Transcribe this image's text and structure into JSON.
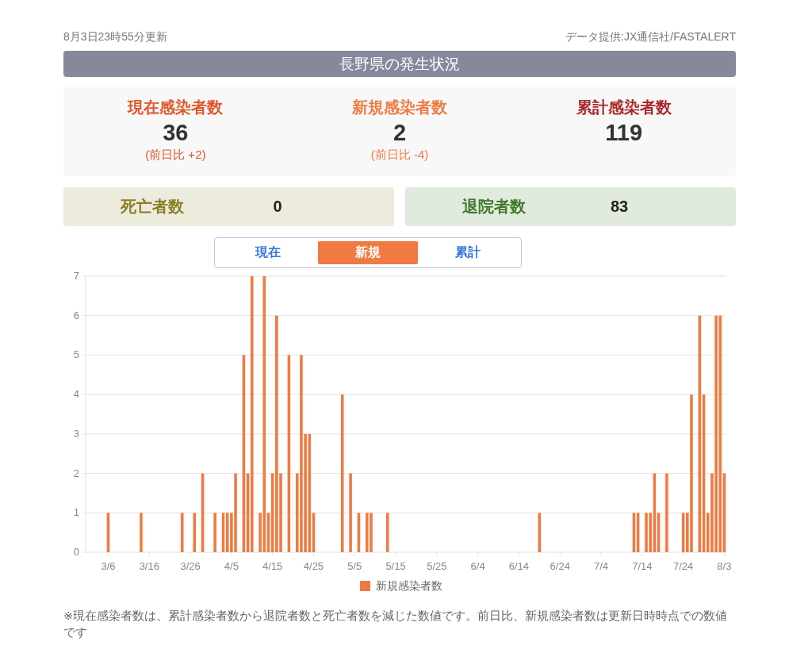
{
  "updated": "8月3日23時55分更新",
  "source": "データ提供:JX通信社/FASTALERT",
  "title": "長野県の発生状況",
  "stats": [
    {
      "label": "現在感染者数",
      "value": "36",
      "change": "(前日比 +2)",
      "color": "#e0562a"
    },
    {
      "label": "新規感染者数",
      "value": "2",
      "change": "(前日比 -4)",
      "color": "#f07a41"
    },
    {
      "label": "累計感染者数",
      "value": "119",
      "color": "#a8282a"
    }
  ],
  "summary_boxes": [
    {
      "label": "死亡者数",
      "value": "0",
      "color": "#8a7f25"
    },
    {
      "label": "退院者数",
      "value": "83",
      "color": "#3d7a2a"
    }
  ],
  "tabs": [
    {
      "label": "現在",
      "selected": false
    },
    {
      "label": "新規",
      "selected": true
    },
    {
      "label": "累計",
      "selected": false
    }
  ],
  "chart_data": {
    "type": "bar",
    "categories": [
      null,
      null,
      null,
      null,
      null,
      "3/6",
      null,
      null,
      null,
      null,
      null,
      null,
      null,
      null,
      null,
      "3/16",
      null,
      null,
      null,
      null,
      null,
      null,
      null,
      null,
      null,
      "3/26",
      null,
      null,
      null,
      null,
      null,
      null,
      null,
      null,
      null,
      "4/5",
      null,
      null,
      null,
      null,
      null,
      null,
      null,
      null,
      null,
      "4/15",
      null,
      null,
      null,
      null,
      null,
      null,
      null,
      null,
      null,
      "4/25",
      null,
      null,
      null,
      null,
      null,
      null,
      null,
      null,
      null,
      "5/5",
      null,
      null,
      null,
      null,
      null,
      null,
      null,
      null,
      null,
      "5/15",
      null,
      null,
      null,
      null,
      null,
      null,
      null,
      null,
      null,
      "5/25",
      null,
      null,
      null,
      null,
      null,
      null,
      null,
      null,
      null,
      "6/4",
      null,
      null,
      null,
      null,
      null,
      null,
      null,
      null,
      null,
      "6/14",
      null,
      null,
      null,
      null,
      null,
      null,
      null,
      null,
      null,
      "6/24",
      null,
      null,
      null,
      null,
      null,
      null,
      null,
      null,
      null,
      "7/4",
      null,
      null,
      null,
      null,
      null,
      null,
      null,
      null,
      null,
      "7/14",
      null,
      null,
      null,
      null,
      null,
      null,
      null,
      null,
      null,
      "7/24",
      null,
      null,
      null,
      null,
      null,
      null,
      null,
      null,
      null,
      "8/3"
    ],
    "series": [
      {
        "name": "新規感染者数",
        "color": "#f07a41",
        "values": [
          0,
          0,
          0,
          0,
          0,
          1,
          0,
          0,
          0,
          0,
          0,
          0,
          0,
          1,
          0,
          0,
          0,
          0,
          0,
          0,
          0,
          0,
          0,
          1,
          0,
          0,
          1,
          0,
          2,
          0,
          0,
          1,
          0,
          1,
          1,
          1,
          2,
          0,
          5,
          2,
          7,
          0,
          1,
          7,
          1,
          2,
          6,
          2,
          0,
          5,
          0,
          2,
          5,
          3,
          3,
          1,
          0,
          0,
          0,
          0,
          0,
          0,
          4,
          0,
          2,
          0,
          1,
          0,
          1,
          1,
          0,
          0,
          0,
          1,
          0,
          0,
          0,
          0,
          0,
          0,
          0,
          0,
          0,
          0,
          0,
          0,
          0,
          0,
          0,
          0,
          0,
          0,
          0,
          0,
          0,
          0,
          0,
          0,
          0,
          0,
          0,
          0,
          0,
          0,
          0,
          0,
          0,
          0,
          0,
          0,
          1,
          0,
          0,
          0,
          0,
          0,
          0,
          0,
          0,
          0,
          0,
          0,
          0,
          0,
          0,
          0,
          0,
          0,
          0,
          0,
          0,
          0,
          0,
          1,
          1,
          0,
          1,
          1,
          2,
          1,
          0,
          2,
          0,
          0,
          0,
          1,
          1,
          4,
          0,
          6,
          4,
          1,
          2,
          6,
          6,
          2
        ]
      }
    ],
    "grid": true,
    "ylim": [
      0,
      7
    ],
    "yticks": [
      0,
      1,
      2,
      3,
      4,
      5,
      6,
      7
    ]
  },
  "footnote": "※現在感染者数は、累計感染者数から退院者数と死亡者数を減じた数値です。前日比、新規感染者数は更新日時時点での数値です"
}
